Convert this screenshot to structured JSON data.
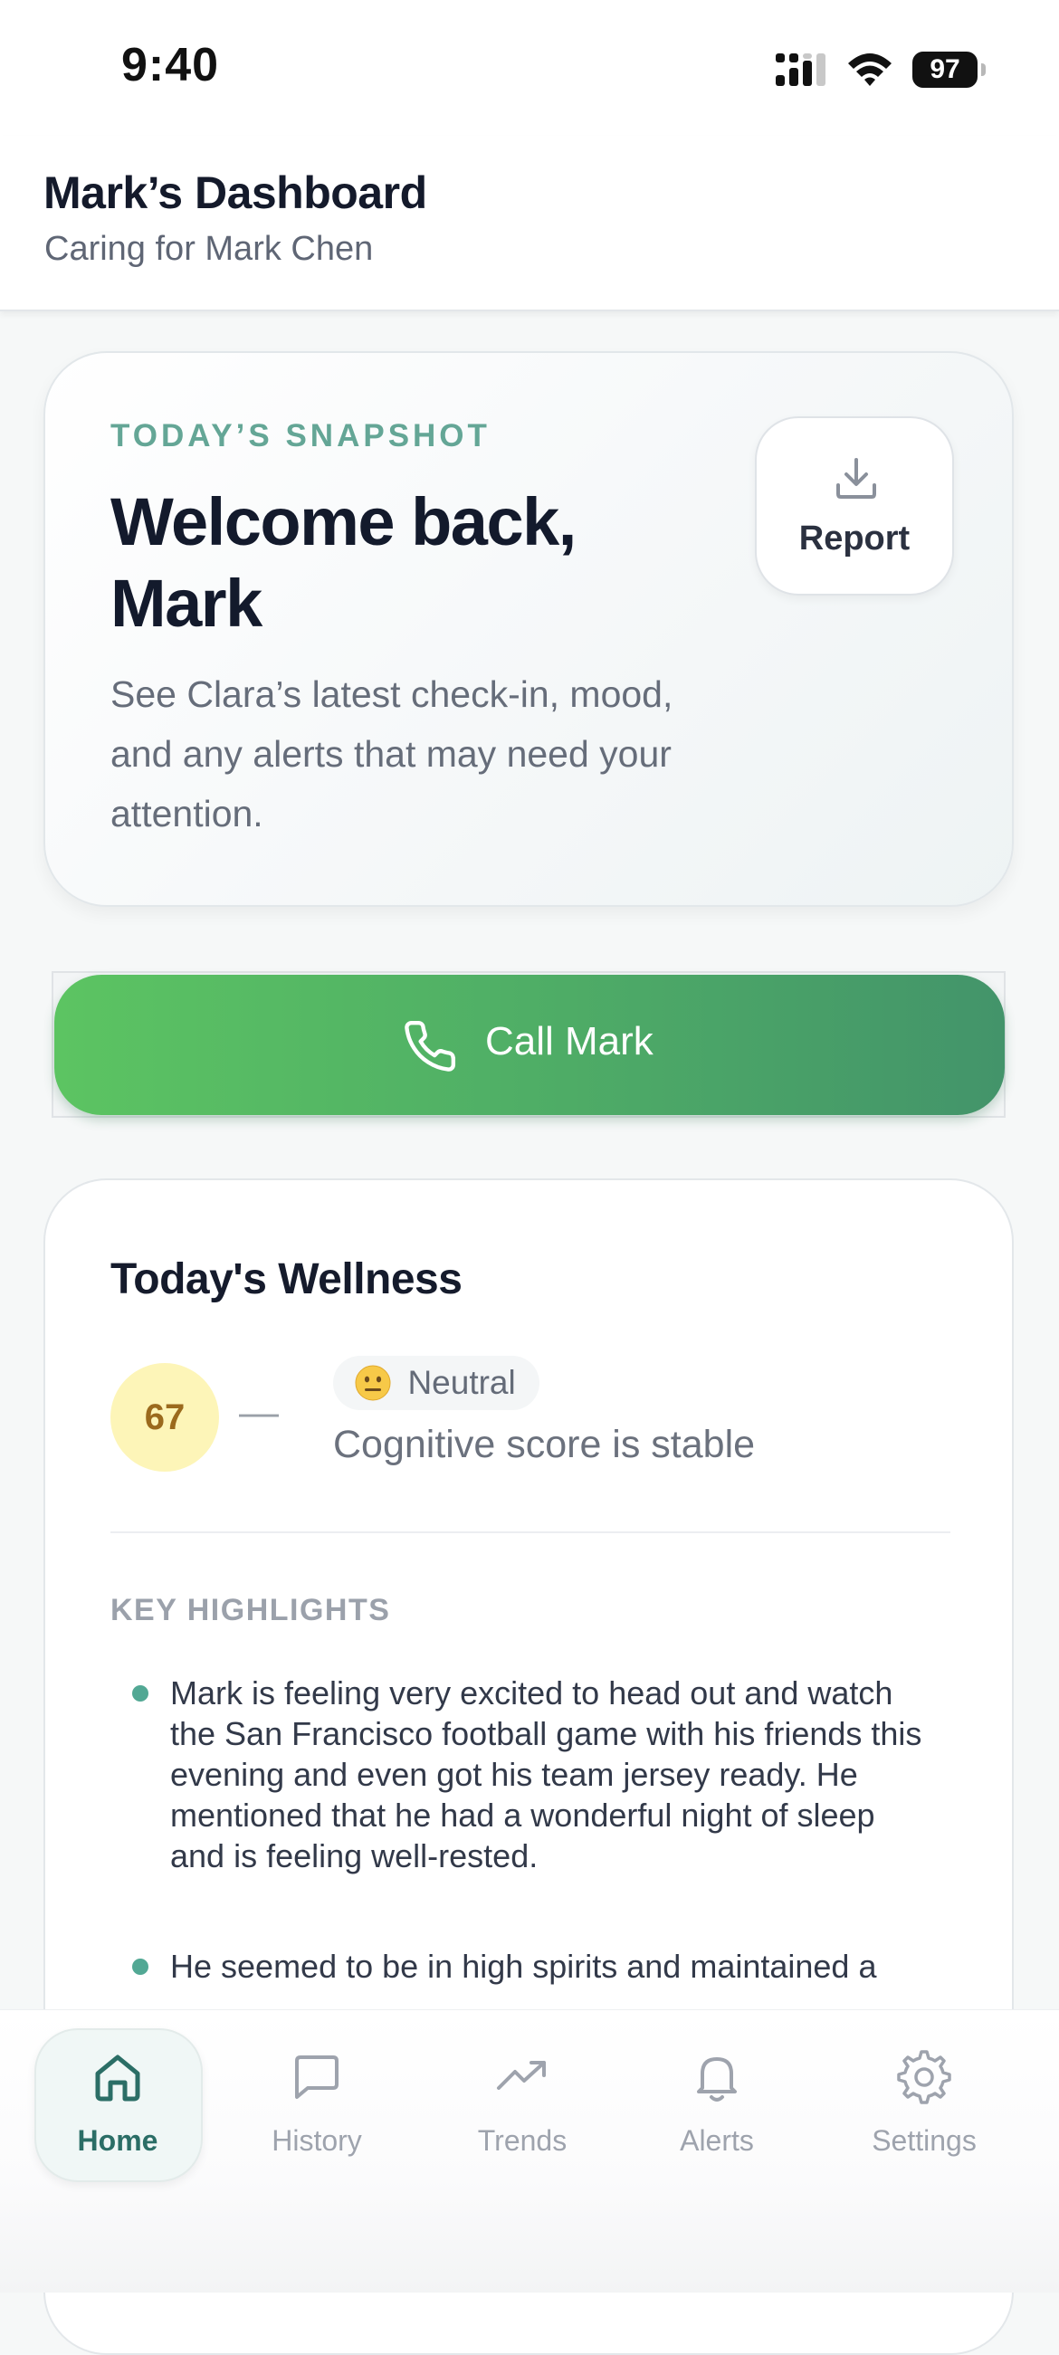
{
  "status_bar": {
    "time": "9:40",
    "battery": "97"
  },
  "header": {
    "title": "Mark’s Dashboard",
    "subtitle": "Caring for Mark Chen"
  },
  "snapshot": {
    "eyebrow": "TODAY’S SNAPSHOT",
    "heading_line1": "Welcome back,",
    "heading_line2": "Mark",
    "description": "See Clara’s latest check-in, mood, and any alerts that may need your attention.",
    "report_button_label": "Report",
    "report_icon": "download-icon"
  },
  "call_button": {
    "label": "Call Mark",
    "icon": "phone-icon"
  },
  "wellness": {
    "title": "Today's Wellness",
    "score": "67",
    "trend_symbol": "—",
    "mood_emoji": "neutral-face-emoji",
    "mood_label": "Neutral",
    "status_text": "Cognitive score is stable",
    "highlights_label": "KEY HIGHLIGHTS",
    "highlights": [
      "Mark is feeling very excited to head out and watch the San Francisco football game with his friends this evening and even got his team jersey ready. He mentioned that he had a wonderful night of sleep and is feeling well-rested.",
      "He seemed to be in high spirits and maintained a"
    ]
  },
  "bottom_nav": {
    "items": [
      {
        "label": "Home",
        "icon": "home-icon",
        "active": true
      },
      {
        "label": "History",
        "icon": "message-icon",
        "active": false
      },
      {
        "label": "Trends",
        "icon": "trending-up-icon",
        "active": false
      },
      {
        "label": "Alerts",
        "icon": "bell-icon",
        "active": false
      },
      {
        "label": "Settings",
        "icon": "gear-icon",
        "active": false
      }
    ]
  },
  "colors": {
    "accent_green": "#52a894",
    "call_gradient_start": "#5cc462",
    "call_gradient_end": "#43946a",
    "score_bg": "#fdf5b8",
    "score_text": "#9b6a1d",
    "nav_active": "#2b6e66"
  }
}
